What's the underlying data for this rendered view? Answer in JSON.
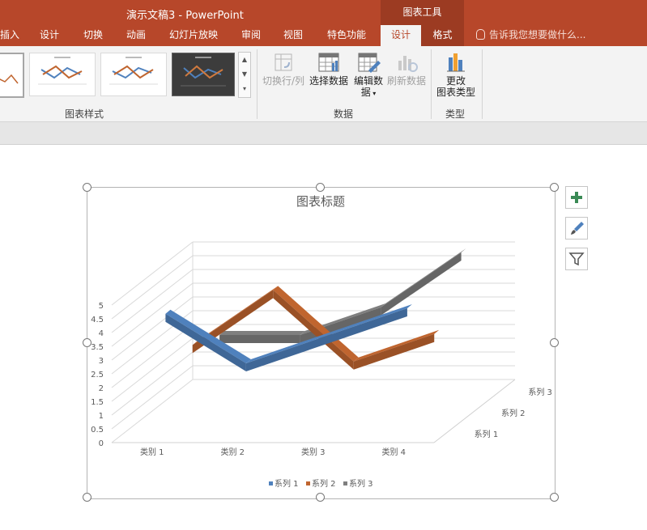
{
  "window": {
    "title": "演示文稿3 - PowerPoint",
    "context_group": "图表工具"
  },
  "tabs": [
    {
      "label": "插入"
    },
    {
      "label": "设计"
    },
    {
      "label": "切换"
    },
    {
      "label": "动画"
    },
    {
      "label": "幻灯片放映"
    },
    {
      "label": "审阅"
    },
    {
      "label": "视图"
    },
    {
      "label": "特色功能"
    },
    {
      "label": "设计",
      "active": true,
      "context": true
    },
    {
      "label": "格式",
      "context": true
    }
  ],
  "tell_me": "告诉我您想要做什么...",
  "ribbon": {
    "styles_group": {
      "label": "图表样式"
    },
    "data_group": {
      "label": "数据",
      "buttons": [
        {
          "label": "切换行/列",
          "disabled": true,
          "icon": "switch-row-column-icon"
        },
        {
          "label": "选择数据",
          "disabled": false,
          "icon": "select-data-icon"
        },
        {
          "label": "编辑数",
          "label2": "据",
          "disabled": false,
          "icon": "edit-data-icon"
        },
        {
          "label": "刷新数据",
          "disabled": true,
          "icon": "refresh-data-icon"
        }
      ]
    },
    "type_group": {
      "label": "类型",
      "button": {
        "label": "更改",
        "label2": "图表类型",
        "icon": "change-chart-type-icon"
      }
    }
  },
  "side_buttons": [
    {
      "icon": "chart-elements-plus-icon"
    },
    {
      "icon": "chart-styles-brush-icon"
    },
    {
      "icon": "chart-filters-funnel-icon"
    }
  ],
  "chart_data": {
    "type": "line",
    "subtype": "3d-line",
    "title": "图表标题",
    "categories": [
      "类别 1",
      "类别 2",
      "类别 3",
      "类别 4"
    ],
    "series": [
      {
        "name": "系列 1",
        "color": "#4f81bd",
        "values": [
          4.3,
          2.5,
          3.5,
          4.5
        ]
      },
      {
        "name": "系列 2",
        "color": "#c0652f",
        "values": [
          2.4,
          4.4,
          1.8,
          2.8
        ]
      },
      {
        "name": "系列 3",
        "color": "#7f7f7f",
        "values": [
          2,
          2,
          3,
          5
        ]
      }
    ],
    "y_ticks": [
      "0",
      "0.5",
      "1",
      "1.5",
      "2",
      "2.5",
      "3",
      "3.5",
      "4",
      "4.5",
      "5"
    ],
    "depth_labels": [
      "系列 1",
      "系列 2",
      "系列 3"
    ],
    "ylim": [
      0,
      5
    ],
    "grid": true,
    "legend_position": "bottom"
  }
}
